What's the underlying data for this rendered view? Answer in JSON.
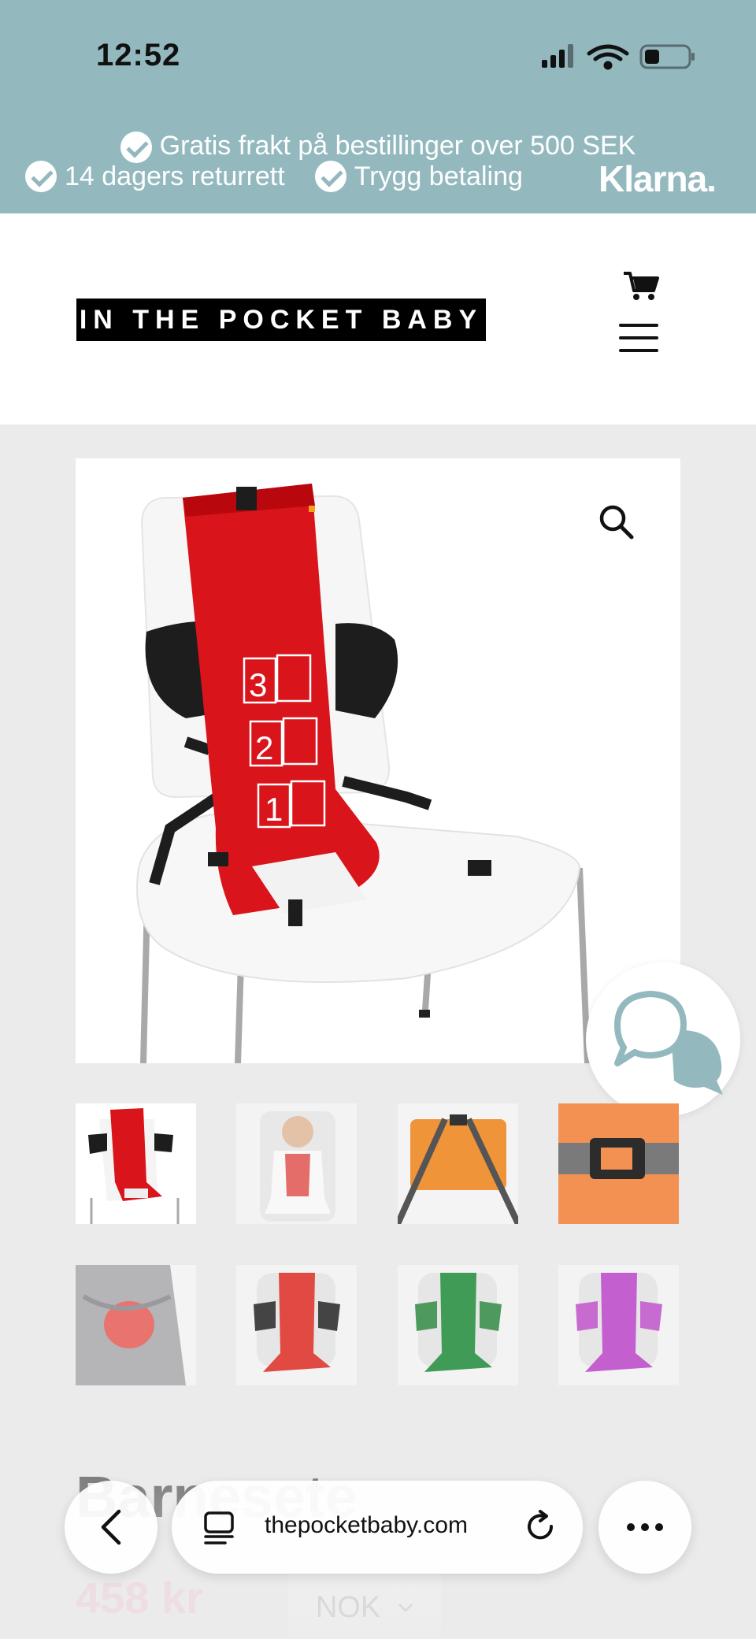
{
  "status_bar": {
    "time": "12:52",
    "signal_icon": "cellular-signal-icon",
    "wifi_icon": "wifi-icon",
    "battery_icon": "battery-icon"
  },
  "promo_bar": {
    "line1": "Gratis frakt på bestillinger over 500 SEK",
    "returns": "14 dagers returrett",
    "payment": "Trygg betaling",
    "klarna": "Klarna."
  },
  "header": {
    "logo": "IN THE POCKET BABY",
    "cart_icon": "cart-icon",
    "menu_icon": "hamburger-menu-icon"
  },
  "gallery": {
    "zoom_icon": "magnifier-icon",
    "chat_icon": "chat-bubbles-icon",
    "thumbnails": [
      "red-chair-harness",
      "baby-in-harness",
      "orange-pouch",
      "buckle-closeup",
      "pouch-in-pocket",
      "red-variant",
      "green-variant",
      "purple-variant"
    ]
  },
  "product": {
    "title": "Barnesete",
    "price": "458 kr",
    "currency": "NOK"
  },
  "browser": {
    "url": "thepocketbaby.com",
    "back_icon": "chevron-left-icon",
    "reader_icon": "reader-mode-icon",
    "reload_icon": "reload-icon",
    "more_icon": "more-dots-icon"
  },
  "colors": {
    "promo_bg": "#93b9bf",
    "page_bg": "#ebebeb",
    "harness_red": "#d9141b",
    "price_pink": "#f3c6d2"
  }
}
